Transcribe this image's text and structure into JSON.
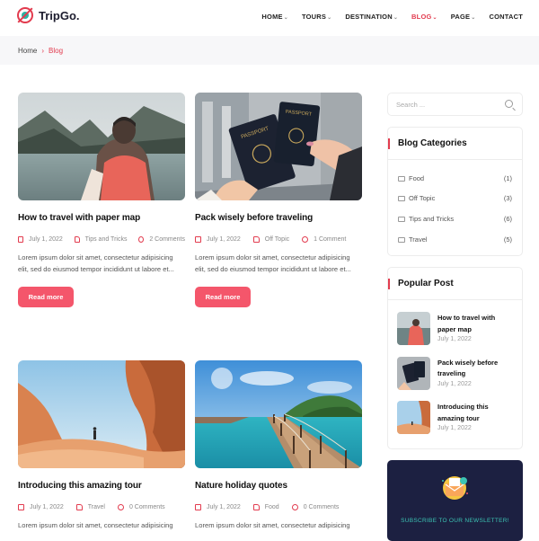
{
  "brand": {
    "name": "TripGo."
  },
  "nav": {
    "items": [
      {
        "label": "HOME",
        "has_menu": true
      },
      {
        "label": "TOURS",
        "has_menu": true
      },
      {
        "label": "DESTINATION",
        "has_menu": true
      },
      {
        "label": "BLOG",
        "has_menu": true,
        "active": true
      },
      {
        "label": "PAGE",
        "has_menu": true
      },
      {
        "label": "CONTACT",
        "has_menu": false
      }
    ]
  },
  "breadcrumb": {
    "home": "Home",
    "separator": "›",
    "current": "Blog"
  },
  "posts": [
    {
      "title": "How to travel with paper map",
      "date": "July 1, 2022",
      "category": "Tips and Tricks",
      "comments": "2 Comments",
      "excerpt": "Lorem ipsum dolor sit amet, consectetur adipisicing elit, sed do eiusmod tempor incididunt ut labore et...",
      "button": "Read more"
    },
    {
      "title": "Pack wisely before traveling",
      "date": "July 1, 2022",
      "category": "Off Topic",
      "comments": "1 Comment",
      "excerpt": "Lorem ipsum dolor sit amet, consectetur adipisicing elit, sed do eiusmod tempor incididunt ut labore et...",
      "button": "Read more"
    },
    {
      "title": "Introducing this amazing tour",
      "date": "July 1, 2022",
      "category": "Travel",
      "comments": "0 Comments",
      "excerpt": "Lorem ipsum dolor sit amet, consectetur adipisicing"
    },
    {
      "title": "Nature holiday quotes",
      "date": "July 1, 2022",
      "category": "Food",
      "comments": "0 Comments",
      "excerpt": "Lorem ipsum dolor sit amet, consectetur adipisicing"
    }
  ],
  "sidebar": {
    "search": {
      "placeholder": "Search ..."
    },
    "categories": {
      "title": "Blog Categories",
      "items": [
        {
          "label": "Food",
          "count": "(1)"
        },
        {
          "label": "Off Topic",
          "count": "(3)"
        },
        {
          "label": "Tips and Tricks",
          "count": "(6)"
        },
        {
          "label": "Travel",
          "count": "(5)"
        }
      ]
    },
    "popular": {
      "title": "Popular Post",
      "items": [
        {
          "title_line1": "How to travel with",
          "title_line2": "paper map",
          "date": "July 1, 2022"
        },
        {
          "title_line1": "Pack wisely before",
          "title_line2": "traveling",
          "date": "July 1, 2022"
        },
        {
          "title_line1": "Introducing this",
          "title_line2": "amazing tour",
          "date": "July 1, 2022"
        }
      ]
    },
    "newsletter": {
      "title": "SUBSCRIBE TO OUR NEWSLETTER!"
    }
  },
  "colors": {
    "accent": "#e23b4e",
    "button": "#f4566b",
    "newsletter_bg": "#1c2041",
    "teal": "#3cc4b4"
  }
}
